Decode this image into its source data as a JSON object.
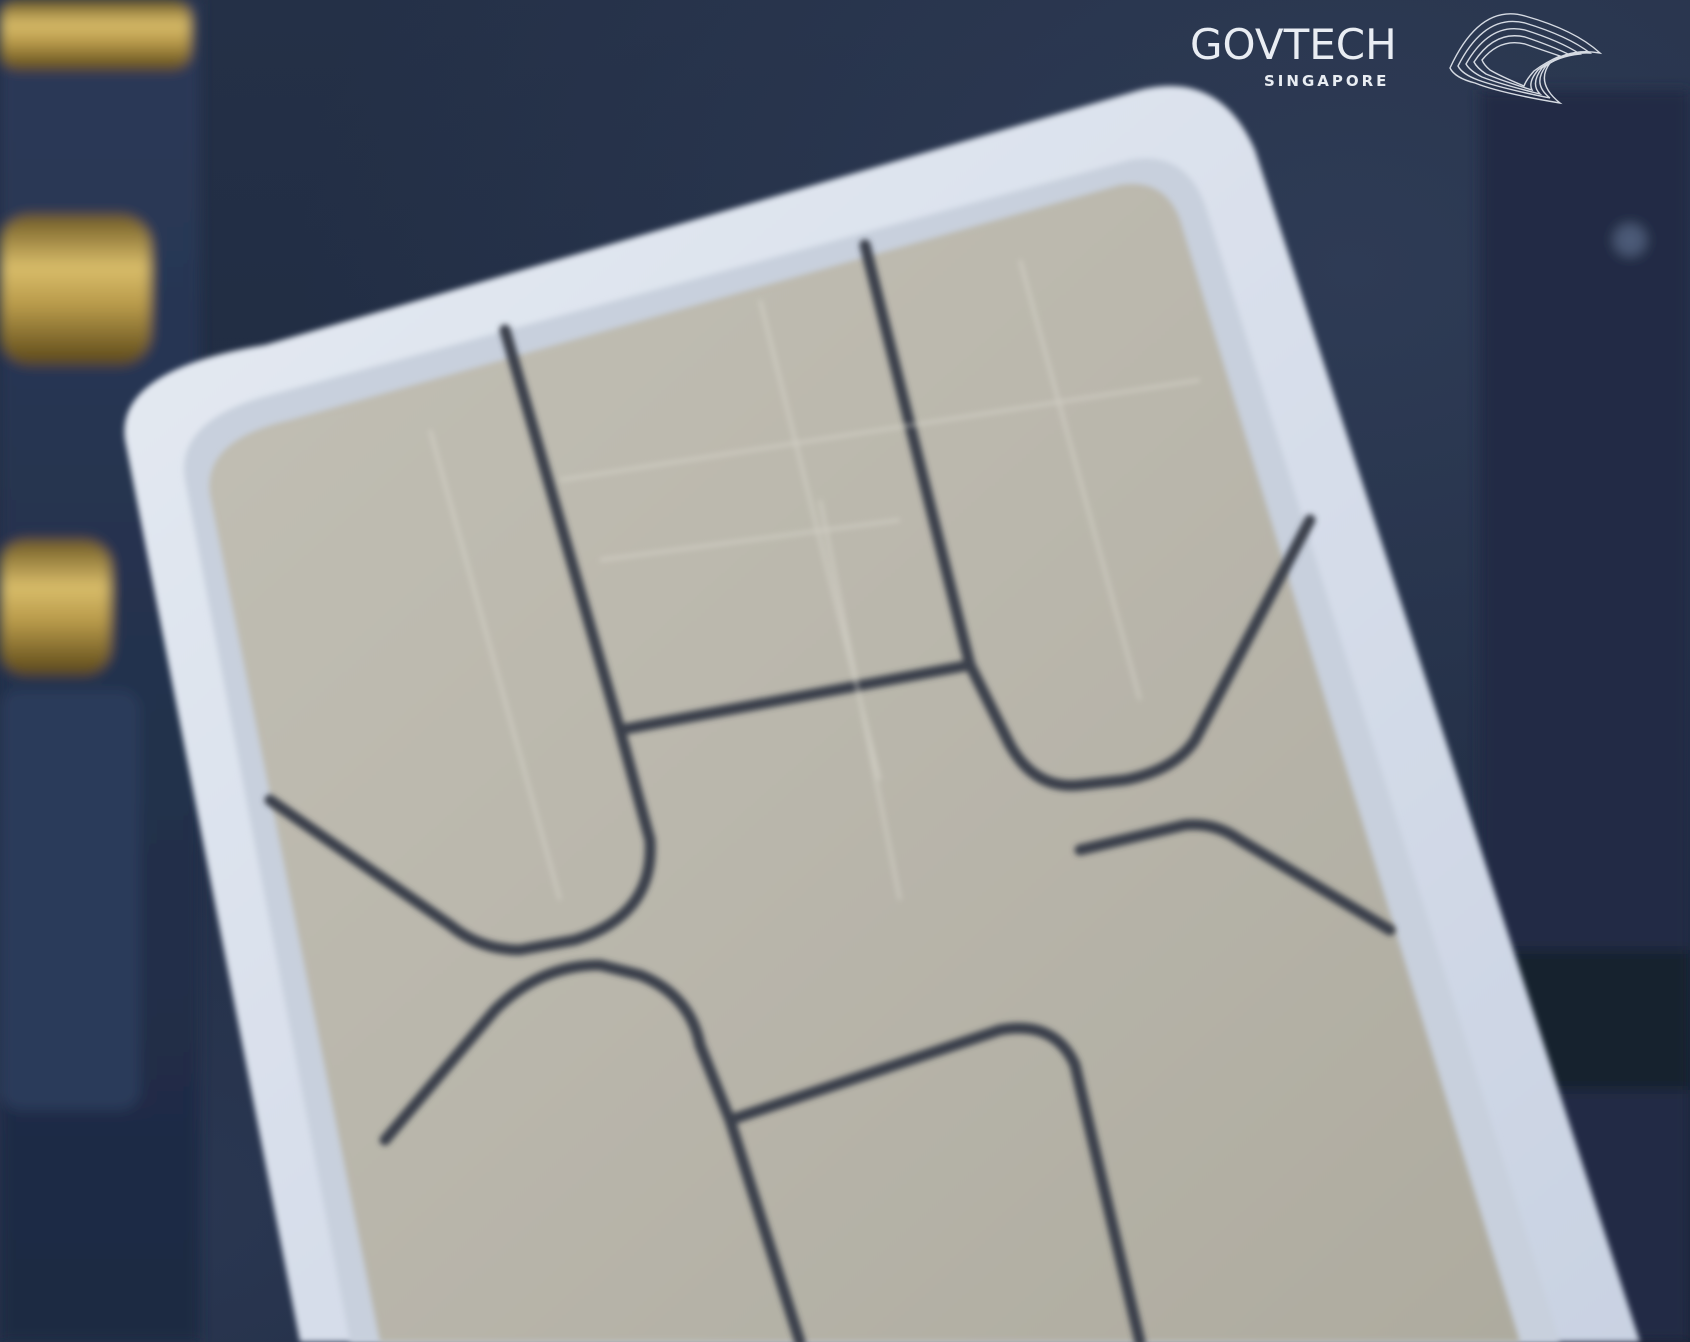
{
  "logo": {
    "wordmark": "GOVTECH",
    "subtitle": "SINGAPORE",
    "mark_icon": "wave-ribbon-icon"
  },
  "scene": {
    "subject": "sim-card-closeup",
    "colors": {
      "background": "#1e2a40",
      "sim_frame": "#d9e0ec",
      "chip_contacts": "#b8b5aa",
      "chip_lines": "#3b3f4c",
      "brass_springs": "#b89a4a"
    }
  }
}
